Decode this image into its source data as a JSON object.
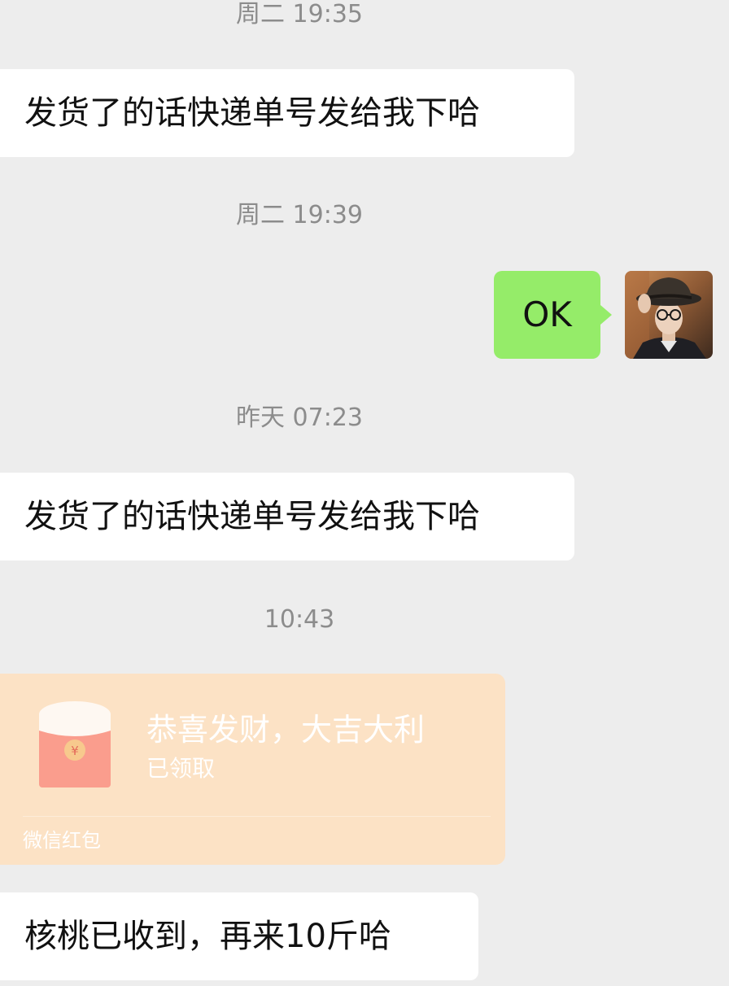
{
  "messages": [
    {
      "type": "timestamp",
      "text": "周二 19:35"
    },
    {
      "type": "incoming",
      "text": "发货了的话快递单号发给我下哈"
    },
    {
      "type": "timestamp",
      "text": "周二 19:39"
    },
    {
      "type": "outgoing",
      "text": "OK"
    },
    {
      "type": "timestamp",
      "text": "昨天 07:23"
    },
    {
      "type": "incoming",
      "text": "发货了的话快递单号发给我下哈"
    },
    {
      "type": "timestamp",
      "text": "10:43"
    },
    {
      "type": "red_packet",
      "title": "恭喜发财，大吉大利",
      "status": "已领取",
      "footer": "微信红包",
      "symbol": "¥"
    },
    {
      "type": "incoming",
      "text": "核桃已收到，再来10斤哈"
    }
  ],
  "colors": {
    "background": "#ededed",
    "incoming_bubble": "#ffffff",
    "outgoing_bubble": "#95ec69",
    "red_packet_card": "#fce2c5",
    "red_packet_envelope": "#fa9d8d",
    "timestamp_text": "#8c8c8c"
  },
  "icons": {
    "avatar": "user-avatar-man-in-hat",
    "red_packet": "red-envelope-icon"
  }
}
